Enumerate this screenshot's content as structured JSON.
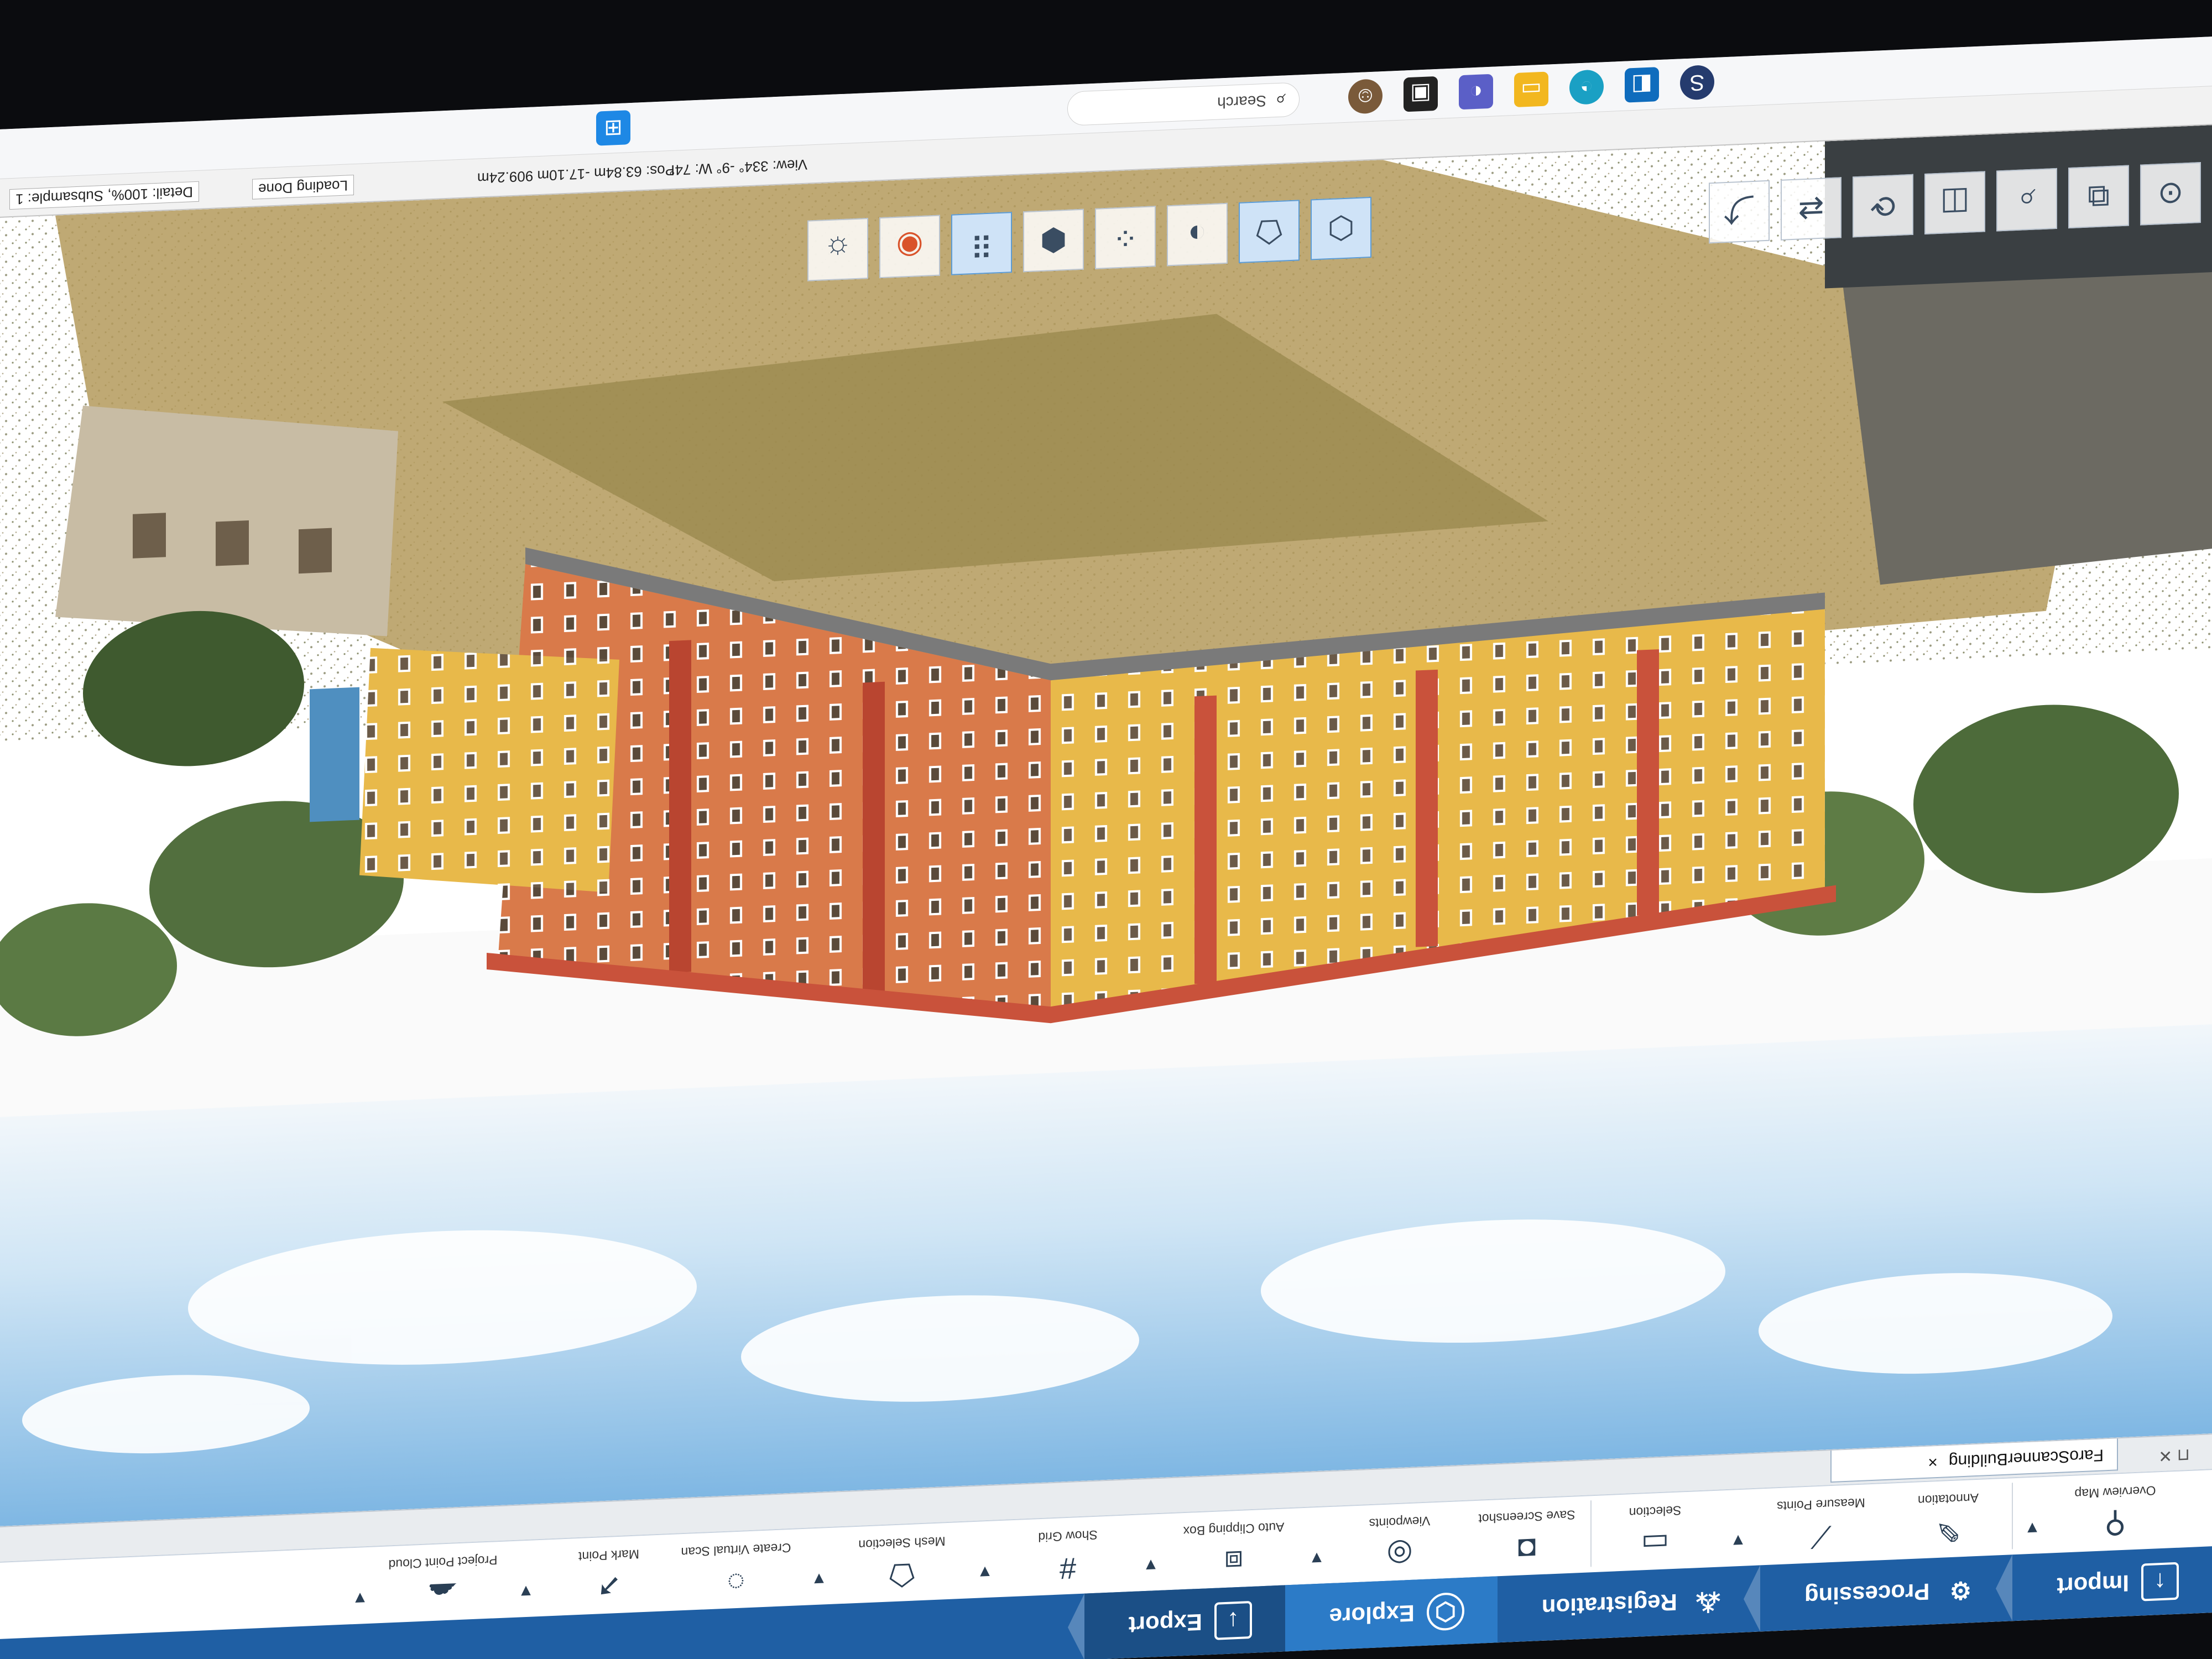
{
  "ribbon": {
    "tabs": [
      {
        "label": "Import",
        "icon": "import-icon"
      },
      {
        "label": "Processing",
        "icon": "processing-icon"
      },
      {
        "label": "Registration",
        "icon": "registration-icon"
      },
      {
        "label": "Explore",
        "icon": "explore-icon"
      },
      {
        "label": "Export",
        "icon": "export-icon"
      }
    ],
    "active_tab": "Explore",
    "tools": {
      "overview_map": "Overview Map",
      "annotation": "Annotation",
      "measure_points": "Measure Points",
      "selection": "Selection",
      "save_screenshot": "Save Screenshot",
      "viewpoints": "Viewpoints",
      "auto_clipping_box": "Auto Clipping Box",
      "show_grid": "Show Grid",
      "mesh_selection": "Mesh Selection",
      "create_virtual_scan": "Create Virtual Scan",
      "mark_point": "Mark Point",
      "project_point_cloud": "Project Point Cloud"
    }
  },
  "document": {
    "tab_label": "FaroScannerBuilding",
    "close_symbol": "×",
    "pin_symbols": "⊓ ✕"
  },
  "status": {
    "detail": "Detail: 100%, Subsample: 1",
    "loading": "Loading Done",
    "pos": "Pos: 63.84m -17.10m 909.24m",
    "view": "View: 334° -9° W: 74°"
  },
  "taskbar": {
    "search_label": "Search"
  },
  "colors": {
    "ribbon_blue": "#1f5fa4",
    "active_tab": "#2c7bc7",
    "facade_yellow": "#e8b94a",
    "facade_red": "#c9523b"
  }
}
